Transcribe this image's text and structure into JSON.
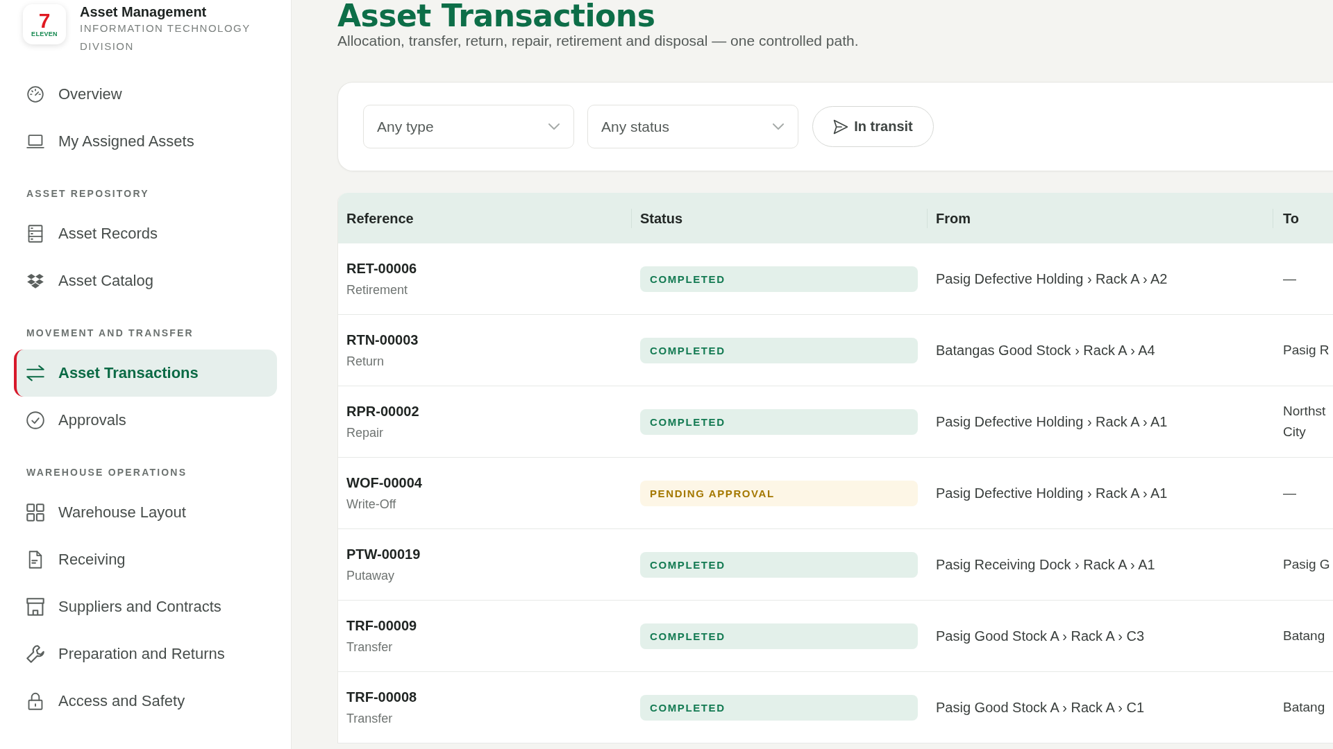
{
  "sidebar": {
    "brand": {
      "logo_numeral": "7",
      "logo_wordmark": "ELEVEN",
      "title": "Asset Management",
      "subtitle": "INFORMATION TECHNOLOGY DIVISION"
    },
    "sections": [
      {
        "items": [
          {
            "label": "Overview",
            "selected": false
          },
          {
            "label": "My Assigned Assets",
            "selected": false
          }
        ]
      },
      {
        "title": "ASSET REPOSITORY",
        "items": [
          {
            "label": "Asset Records",
            "selected": false
          },
          {
            "label": "Asset Catalog",
            "selected": false
          }
        ]
      },
      {
        "title": "MOVEMENT AND TRANSFER",
        "items": [
          {
            "label": "Asset Transactions",
            "selected": true
          },
          {
            "label": "Approvals",
            "selected": false
          }
        ]
      },
      {
        "title": "WAREHOUSE OPERATIONS",
        "items": [
          {
            "label": "Warehouse Layout",
            "selected": false
          },
          {
            "label": "Receiving",
            "selected": false
          },
          {
            "label": "Suppliers and Contracts",
            "selected": false
          },
          {
            "label": "Preparation and Returns",
            "selected": false
          },
          {
            "label": "Access and Safety",
            "selected": false
          }
        ]
      }
    ]
  },
  "page": {
    "title": "Asset Transactions",
    "subtitle": "Allocation, transfer, return, repair, retirement and disposal — one controlled path."
  },
  "filters": {
    "type_select": {
      "value": "Any type"
    },
    "status_select": {
      "value": "Any status"
    },
    "in_transit": {
      "label": "In transit",
      "on": false
    }
  },
  "table": {
    "columns": [
      "Reference",
      "Status",
      "From",
      "To"
    ],
    "rows": [
      {
        "reference": "RET-00006",
        "type": "Retirement",
        "status": {
          "label": "COMPLETED",
          "kind": "completed"
        },
        "from": "Pasig Defective Holding › Rack A › A2",
        "to": "—"
      },
      {
        "reference": "RTN-00003",
        "type": "Return",
        "status": {
          "label": "COMPLETED",
          "kind": "completed"
        },
        "from": "Batangas Good Stock › Rack A › A4",
        "to": "Pasig R"
      },
      {
        "reference": "RPR-00002",
        "type": "Repair",
        "status": {
          "label": "COMPLETED",
          "kind": "completed"
        },
        "from": "Pasig Defective Holding › Rack A › A1",
        "to": "Northst City"
      },
      {
        "reference": "WOF-00004",
        "type": "Write-Off",
        "status": {
          "label": "PENDING APPROVAL",
          "kind": "pending"
        },
        "from": "Pasig Defective Holding › Rack A › A1",
        "to": "—"
      },
      {
        "reference": "PTW-00019",
        "type": "Putaway",
        "status": {
          "label": "COMPLETED",
          "kind": "completed"
        },
        "from": "Pasig Receiving Dock › Rack A › A1",
        "to": "Pasig G"
      },
      {
        "reference": "TRF-00009",
        "type": "Transfer",
        "status": {
          "label": "COMPLETED",
          "kind": "completed"
        },
        "from": "Pasig Good Stock A › Rack A › C3",
        "to": "Batang"
      },
      {
        "reference": "TRF-00008",
        "type": "Transfer",
        "status": {
          "label": "COMPLETED",
          "kind": "completed"
        },
        "from": "Pasig Good Stock A › Rack A › C1",
        "to": "Batang"
      }
    ]
  }
}
